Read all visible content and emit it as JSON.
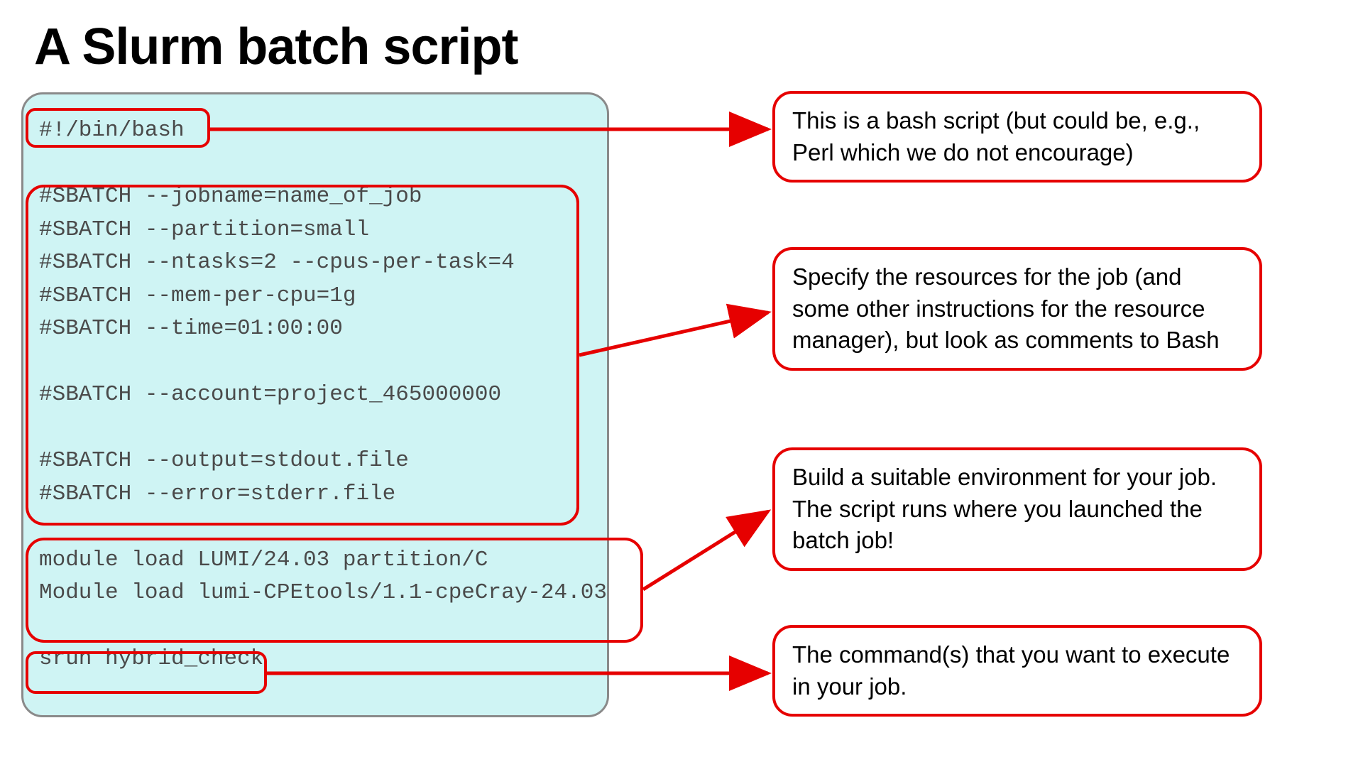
{
  "title": "A Slurm batch script",
  "script": {
    "shebang": "#!/bin/bash",
    "sbatch_lines": "#SBATCH --jobname=name_of_job\n#SBATCH --partition=small\n#SBATCH --ntasks=2 --cpus-per-task=4\n#SBATCH --mem-per-cpu=1g\n#SBATCH --time=01:00:00\n\n#SBATCH --account=project_465000000\n\n#SBATCH --output=stdout.file\n#SBATCH --error=stderr.file",
    "module_lines": "module load LUMI/24.03 partition/C\nModule load lumi-CPEtools/1.1-cpeCray-24.03",
    "run_line": "srun hybrid_check"
  },
  "callouts": {
    "shebang": "This is a bash script (but could be, e.g., Perl which we do not encourage)",
    "sbatch": "Specify the resources for the job (and some other instructions for the resource manager), but look as comments to Bash",
    "env": "Build a suitable environment for your job. The script runs where you launched the batch job!",
    "run": "The command(s) that you want to execute in your job."
  }
}
